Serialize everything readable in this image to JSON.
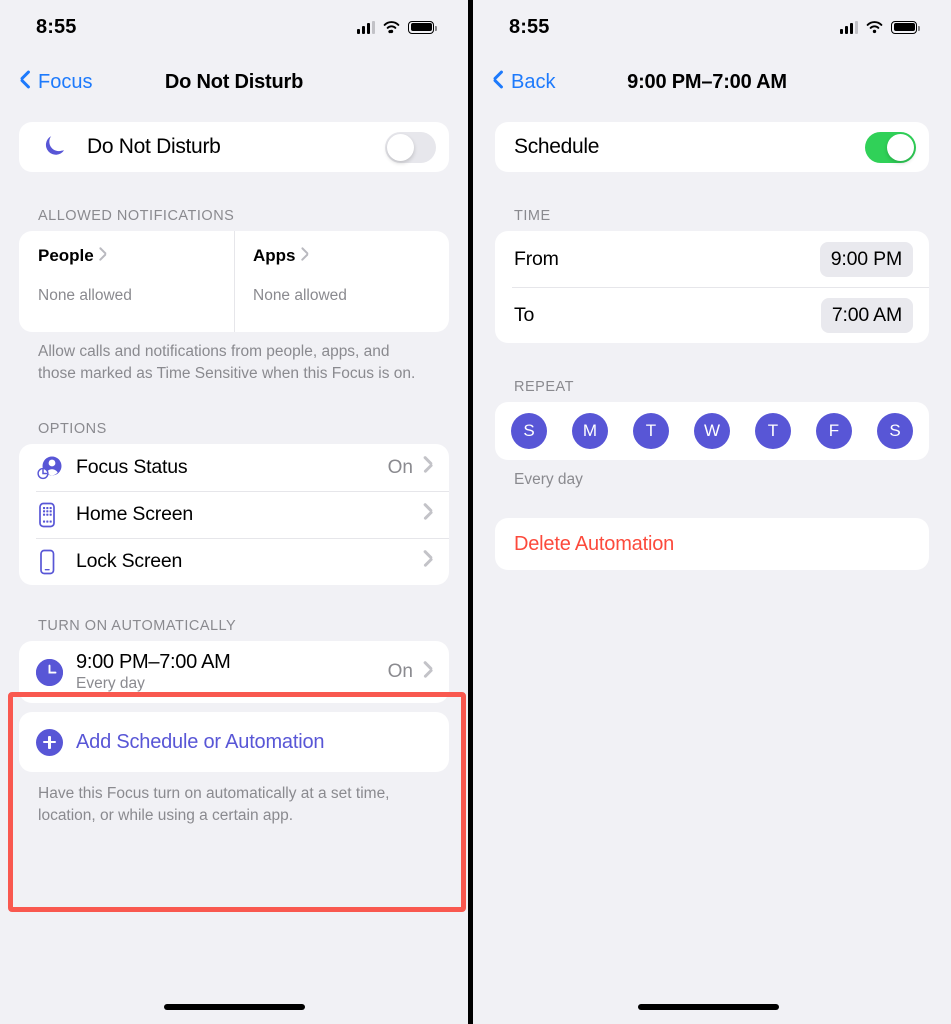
{
  "status_bar": {
    "time": "8:55",
    "cellular_icon": "cellular-bars-icon",
    "wifi_icon": "wifi-icon",
    "battery_icon": "battery-full-icon"
  },
  "left_screen": {
    "nav": {
      "back_label": "Focus",
      "title": "Do Not Disturb",
      "back_icon": "chevron-left-icon"
    },
    "dnd_toggle_row": {
      "label": "Do Not Disturb",
      "icon": "moon-icon",
      "toggle_state": "off"
    },
    "allowed_notifications": {
      "header": "ALLOWED NOTIFICATIONS",
      "cells": [
        {
          "title": "People",
          "subtitle": "None allowed",
          "chevron": "chevron-right-icon"
        },
        {
          "title": "Apps",
          "subtitle": "None allowed",
          "chevron": "chevron-right-icon"
        }
      ],
      "footer": "Allow calls and notifications from people, apps, and those marked as Time Sensitive when this Focus is on."
    },
    "options": {
      "header": "OPTIONS",
      "rows": [
        {
          "label": "Focus Status",
          "value": "On",
          "icon": "focus-status-icon"
        },
        {
          "label": "Home Screen",
          "value": "",
          "icon": "home-screen-icon"
        },
        {
          "label": "Lock Screen",
          "value": "",
          "icon": "lock-screen-icon"
        }
      ]
    },
    "turn_on_automatically": {
      "header": "TURN ON AUTOMATICALLY",
      "schedule": {
        "title": "9:00 PM–7:00 AM",
        "subtitle": "Every day",
        "value": "On",
        "icon": "clock-icon"
      },
      "add": {
        "label": "Add Schedule or Automation",
        "icon": "plus-circle-icon"
      },
      "footer": "Have this Focus turn on automatically at a set time, location, or while using a certain app.",
      "highlight_color": "#f9584f"
    }
  },
  "right_screen": {
    "nav": {
      "back_label": "Back",
      "title": "9:00 PM–7:00 AM",
      "back_icon": "chevron-left-icon"
    },
    "schedule_toggle_row": {
      "label": "Schedule",
      "toggle_state": "on",
      "toggle_color": "#30d158"
    },
    "time": {
      "header": "TIME",
      "rows": [
        {
          "label": "From",
          "value": "9:00 PM"
        },
        {
          "label": "To",
          "value": "7:00 AM"
        }
      ]
    },
    "repeat": {
      "header": "REPEAT",
      "days": [
        {
          "letter": "S",
          "selected": true
        },
        {
          "letter": "M",
          "selected": true
        },
        {
          "letter": "T",
          "selected": true
        },
        {
          "letter": "W",
          "selected": true
        },
        {
          "letter": "T",
          "selected": true
        },
        {
          "letter": "F",
          "selected": true
        },
        {
          "letter": "S",
          "selected": true
        }
      ],
      "footer": "Every day",
      "selected_color": "#5856d6"
    },
    "delete": {
      "label": "Delete Automation",
      "color": "#fc4a3c"
    }
  }
}
